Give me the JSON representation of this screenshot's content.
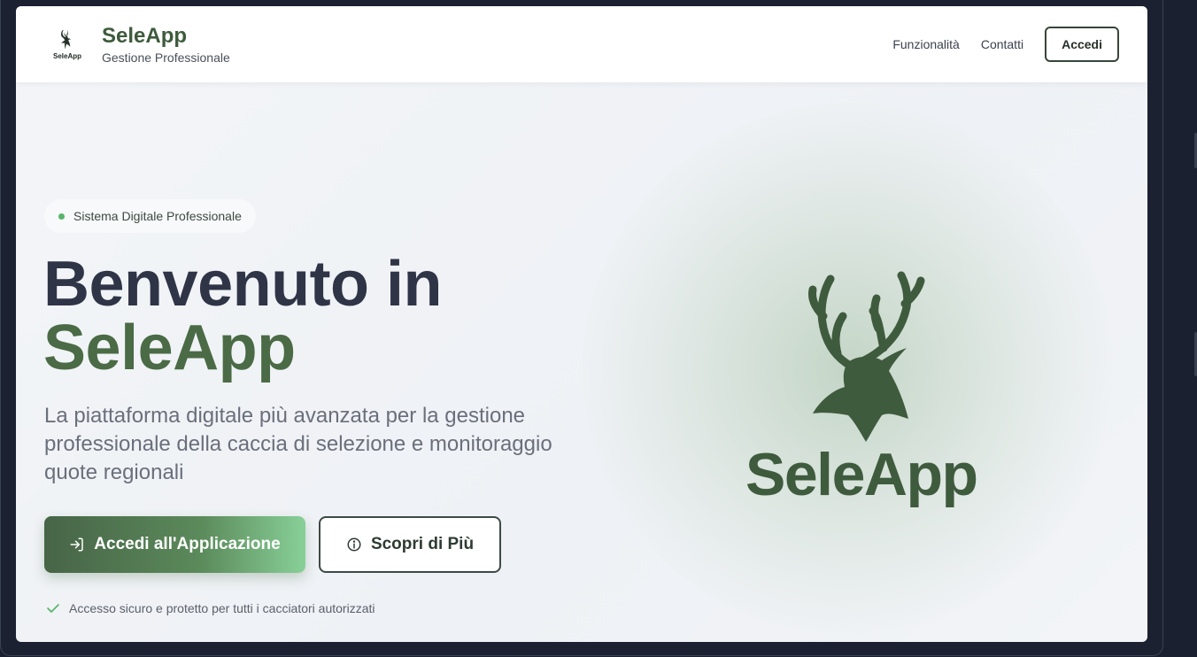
{
  "header": {
    "logo_mini_text": "SeleApp",
    "brand_name": "SeleApp",
    "brand_subtitle": "Gestione Professionale",
    "nav": [
      "Funzionalità",
      "Contatti"
    ],
    "login_label": "Accedi"
  },
  "hero": {
    "badge": "Sistema Digitale Professionale",
    "title_line1": "Benvenuto in",
    "title_line2": "SeleApp",
    "description": "La piattaforma digitale più avanzata per la gestione professionale della caccia di selezione e monitoraggio quote regionali",
    "primary_cta": "Accedi all'Applicazione",
    "secondary_cta": "Scopri di Più",
    "secure_note": "Accesso sicuro e protetto per tutti i cacciatori autorizzati",
    "logo_text": "SeleApp"
  },
  "icons": {
    "logo": "deer-head-icon",
    "primary_cta": "login-icon",
    "secondary_cta": "info-icon",
    "secure": "check-icon",
    "badge_dot": "status-dot"
  },
  "colors": {
    "brand_green": "#3d5b3b",
    "accent_green": "#56b56a",
    "title_dark": "#2f3447",
    "outer_bg": "#1a2030"
  }
}
